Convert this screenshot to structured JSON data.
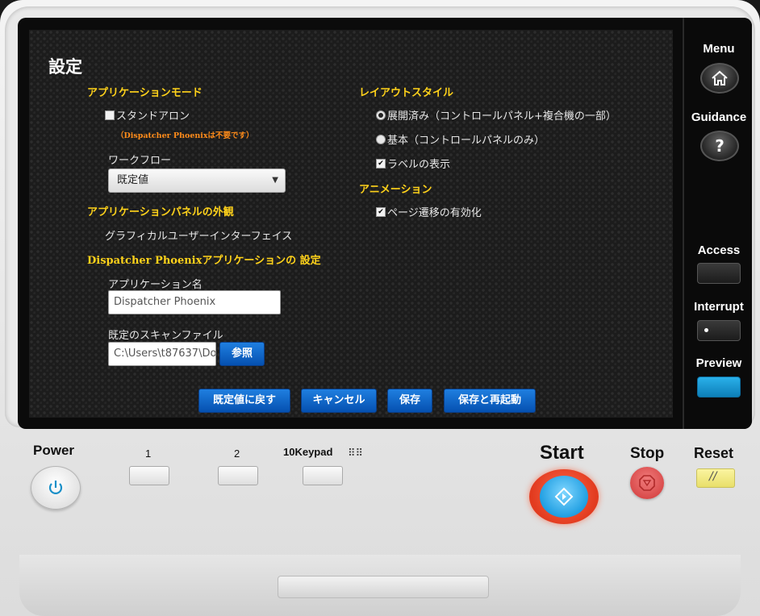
{
  "screen": {
    "title": "設定",
    "left_column": {
      "app_mode": {
        "heading": "アプリケーションモード",
        "standalone_label": "スタンドアロン",
        "standalone_checked": false,
        "standalone_note": "（Dispatcher Phoenixは不要です）",
        "workflow_label": "ワークフロー",
        "workflow_value": "既定値"
      },
      "panel_appearance": {
        "heading": "アプリケーションパネルの外観",
        "value": "グラフィカルユーザーインターフェイス"
      },
      "dp_settings": {
        "heading": "Dispatcher Phoenixアプリケーションの 設定",
        "app_name_label": "アプリケーション名",
        "app_name_value": "Dispatcher Phoenix",
        "scan_file_label": "既定のスキャンファイル",
        "scan_file_value": "C:\\Users\\t87637\\Do",
        "browse_label": "参照"
      }
    },
    "right_column": {
      "layout": {
        "heading": "レイアウトスタイル",
        "option_expanded": "展開済み（コントロールパネル+複合機の一部）",
        "option_basic": "基本（コントロールパネルのみ）",
        "selected": "展開済み（コントロールパネル+複合機の一部）",
        "show_labels": "ラベルの表示",
        "show_labels_checked": true
      },
      "animation": {
        "heading": "アニメーション",
        "page_transition": "ページ遷移の有効化",
        "page_transition_checked": true
      }
    },
    "actions": {
      "reset_default": "既定値に戻す",
      "cancel": "キャンセル",
      "save": "保存",
      "save_restart": "保存と再起動"
    }
  },
  "sidebar": {
    "menu": "Menu",
    "guidance": "Guidance",
    "guidance_symbol": "?",
    "access": "Access",
    "interrupt": "Interrupt",
    "preview": "Preview",
    "menu_icon": "home-icon",
    "guidance_icon": "question-icon"
  },
  "hardware": {
    "power": "Power",
    "key1": "1",
    "key2": "2",
    "keypad": "10Keypad",
    "start": "Start",
    "stop": "Stop",
    "reset": "Reset"
  },
  "colors": {
    "section_heading": "#ffd21a",
    "note": "#ff8c1a",
    "button_blue": "#0a5fc8",
    "preview_blue": "#1a9ad8",
    "start_blue": "#2aa8e0",
    "stop_red": "#e05050",
    "reset_yellow": "#f2ec8a"
  }
}
